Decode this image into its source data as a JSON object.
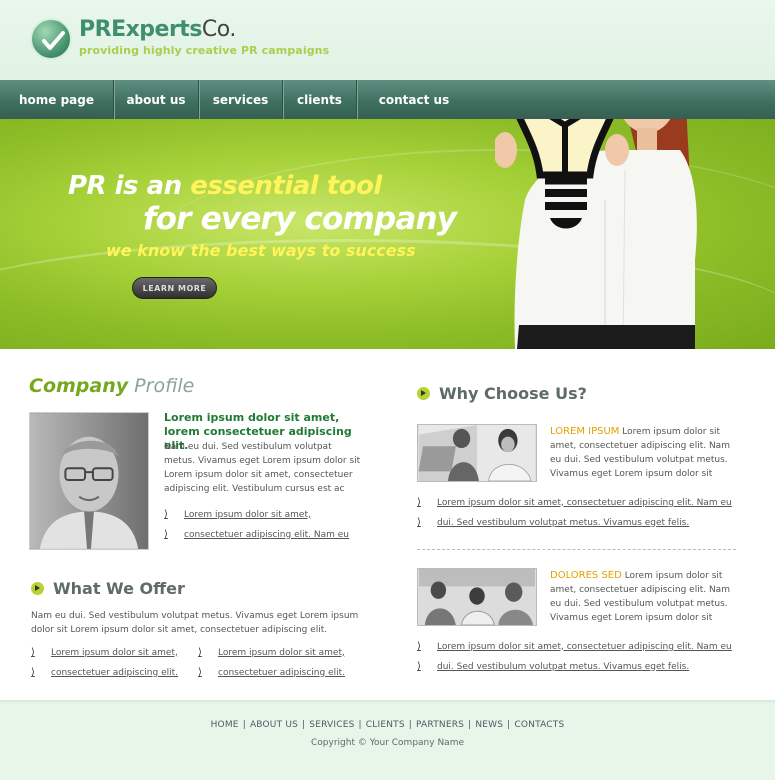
{
  "brand": {
    "name_part1": "PRExperts",
    "name_part2": "Co.",
    "tagline": "providing highly creative PR campaigns"
  },
  "nav": {
    "items": [
      {
        "label": "home page"
      },
      {
        "label": "about us"
      },
      {
        "label": "services"
      },
      {
        "label": "clients"
      },
      {
        "label": "contact us"
      }
    ]
  },
  "hero": {
    "line1_a": "PR is an ",
    "line1_b": "essential tool",
    "line2": "for every company",
    "line3": "we know the best ways to success",
    "button": "LEARN MORE"
  },
  "profile": {
    "title_bold": "Company",
    "title_light": " Profile",
    "lead": "Lorem ipsum dolor sit amet, lorem consectetuer adipiscing elit.",
    "body": "Nam eu dui. Sed vestibulum volutpat metus. Vivamus eget Lorem ipsum dolor sit Lorem ipsum dolor sit amet, consectetuer adipiscing elit. Vestibulum cursus est ac",
    "links": [
      "Lorem ipsum dolor sit amet,",
      "consectetuer adipiscing elit. Nam eu"
    ]
  },
  "offer": {
    "title": "What We Offer",
    "body": "Nam eu dui. Sed vestibulum volutpat metus. Vivamus eget Lorem ipsum dolor sit Lorem ipsum dolor sit amet, consectetuer adipiscing elit.",
    "links_col1": [
      "Lorem ipsum dolor sit amet,",
      "consectetuer adipiscing elit."
    ],
    "links_col2": [
      "Lorem ipsum dolor sit amet,",
      "consectetuer adipiscing elit."
    ]
  },
  "why": {
    "title": "Why Choose Us?",
    "item1": {
      "head": "LOREM IPSUM",
      "text": " Lorem ipsum dolor sit amet, consectetuer adipiscing elit. Nam eu dui. Sed vestibulum volutpat metus. Vivamus eget Lorem ipsum dolor sit",
      "links": [
        "Lorem ipsum dolor sit amet, consectetuer adipiscing elit. Nam eu",
        "dui. Sed vestibulum volutpat metus. Vivamus eget felis."
      ]
    },
    "item2": {
      "head": "DOLORES SED",
      "text": " Lorem ipsum dolor sit amet, consectetuer adipiscing elit. Nam eu dui. Sed vestibulum volutpat metus. Vivamus eget Lorem ipsum dolor sit",
      "links": [
        "Lorem ipsum dolor sit amet, consectetuer adipiscing elit. Nam eu",
        "dui. Sed vestibulum volutpat metus. Vivamus eget felis."
      ]
    }
  },
  "footer": {
    "links": [
      "HOME",
      "ABOUT US",
      "SERVICES",
      "CLIENTS",
      "PARTNERS",
      "NEWS",
      "CONTACTS"
    ],
    "separator": "|",
    "copyright": "Copyright © Your Company Name"
  },
  "colors": {
    "accent_green": "#76a81e",
    "nav_teal": "#3f7060",
    "headline_yellow": "#fff45a",
    "lead_green": "#1f7a35",
    "orange_head": "#e3a200"
  }
}
